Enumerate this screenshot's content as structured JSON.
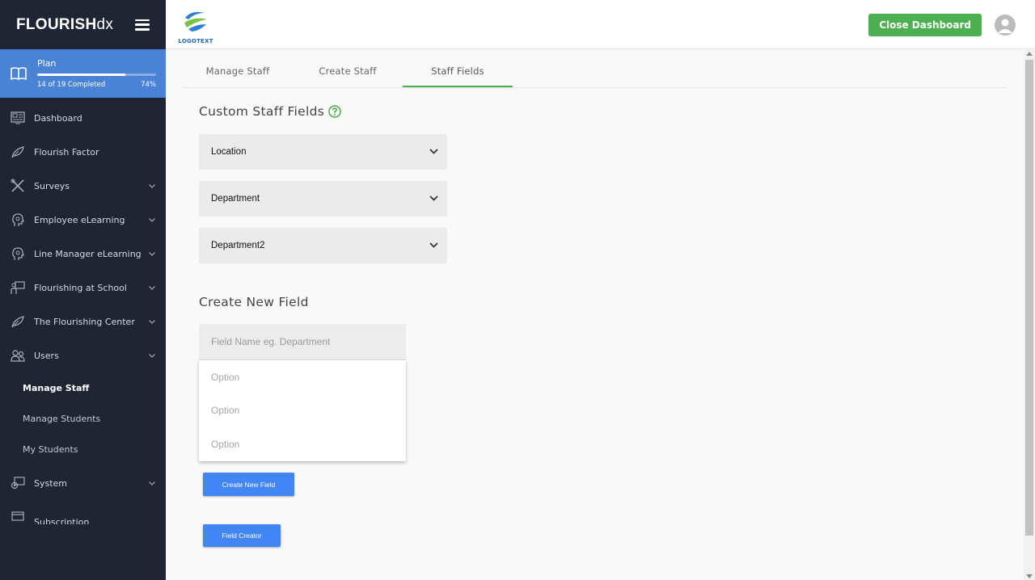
{
  "brand": {
    "name_bold": "FLOURISH",
    "name_light": "dx"
  },
  "plan": {
    "title": "Plan",
    "progress_text": "14 of 19 Completed",
    "percent_text": "74%",
    "percent_value": 74
  },
  "sidebar": {
    "items": [
      {
        "label": "Dashboard",
        "icon": "dashboard-icon",
        "has_chevron": false
      },
      {
        "label": "Flourish Factor",
        "icon": "leaf-icon",
        "has_chevron": false
      },
      {
        "label": "Surveys",
        "icon": "tools-icon",
        "has_chevron": true
      },
      {
        "label": "Employee eLearning",
        "icon": "head-icon",
        "has_chevron": true
      },
      {
        "label": "Line Manager eLearning",
        "icon": "head-icon",
        "has_chevron": true
      },
      {
        "label": "Flourishing at School",
        "icon": "classroom-icon",
        "has_chevron": true
      },
      {
        "label": "The Flourishing Center",
        "icon": "leaf-icon",
        "has_chevron": true
      },
      {
        "label": "Users",
        "icon": "users-icon",
        "has_chevron": true
      }
    ],
    "users_sub": [
      "Manage Staff",
      "Manage Students",
      "My Students"
    ],
    "system_label": "System",
    "subscription_label": "Subscription"
  },
  "topbar": {
    "logo_text": "LOGOTEXT",
    "close_label": "Close Dashboard"
  },
  "tabs": [
    "Manage Staff",
    "Create Staff",
    "Staff Fields"
  ],
  "custom_fields": {
    "title": "Custom Staff Fields",
    "fields": [
      "Location",
      "Department",
      "Department2"
    ]
  },
  "create_field": {
    "title": "Create New Field",
    "placeholder": "Field Name eg. Department",
    "options": [
      "Option",
      "Option",
      "Option"
    ],
    "create_button": "Create New Field",
    "creator_button": "Field Creator"
  },
  "colors": {
    "accent_green": "#4caf50",
    "sidebar_bg": "#1f2533",
    "plan_blue": "#4a83d6",
    "button_blue": "#4285f4"
  }
}
